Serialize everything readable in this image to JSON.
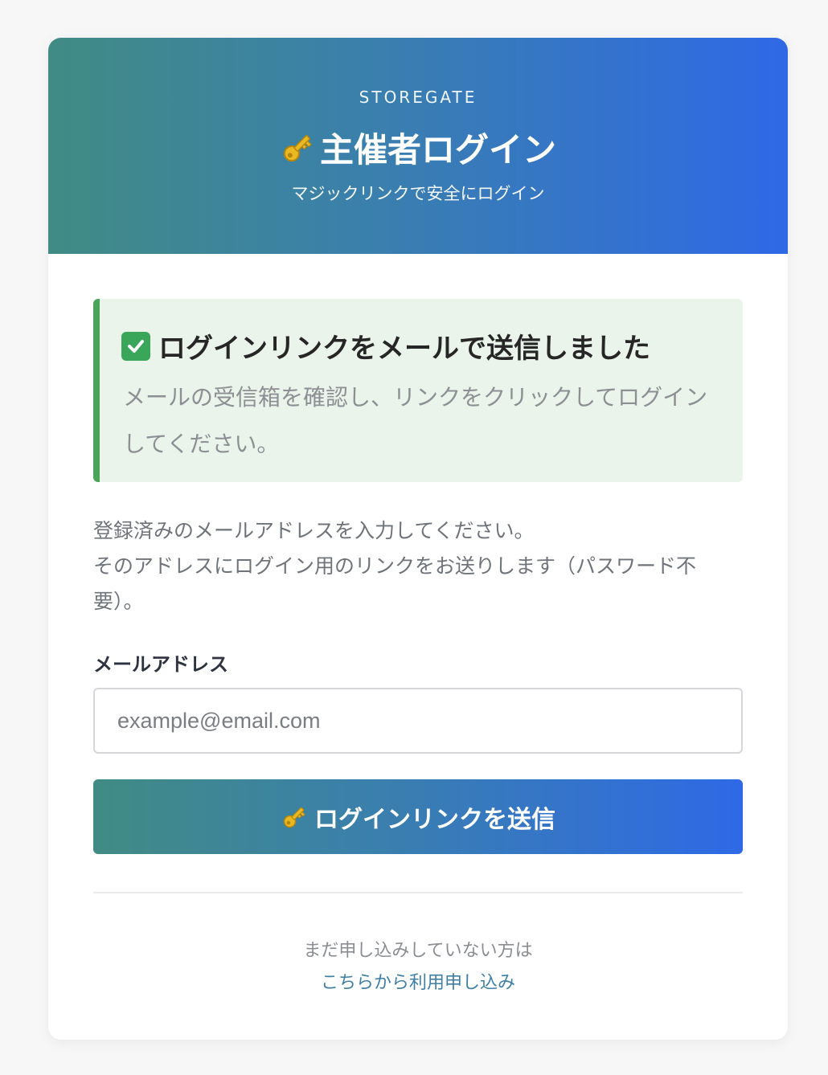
{
  "header": {
    "brand": "STOREGATE",
    "title": "主催者ログイン",
    "subtitle": "マジックリンクで安全にログイン"
  },
  "alert": {
    "title": "ログインリンクをメールで送信しました",
    "message": "メールの受信箱を確認し、リンクをクリックしてログインしてください。"
  },
  "instructions": {
    "line1": "登録済みのメールアドレスを入力してください。",
    "line2": "そのアドレスにログイン用のリンクをお送りします（パスワード不要）。"
  },
  "form": {
    "email_label": "メールアドレス",
    "email_placeholder": "example@email.com",
    "email_value": "",
    "submit_label": "ログインリンクを送信"
  },
  "footer": {
    "prompt": "まだ申し込みしていない方は",
    "link_label": "こちらから利用申し込み"
  },
  "icons": {
    "title_icon": "key-icon",
    "alert_icon": "check-mark-icon",
    "button_icon": "key-icon"
  },
  "colors": {
    "gradient_start": "#418b84",
    "gradient_end": "#2f69e6",
    "alert_bg": "#eaf4ea",
    "alert_border": "#4aa55a",
    "link": "#3f7fa6"
  }
}
